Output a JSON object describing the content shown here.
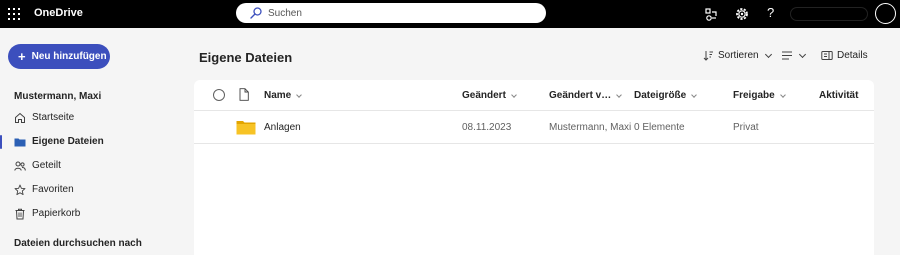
{
  "topbar": {
    "brand": "OneDrive",
    "search_placeholder": "Suchen",
    "help_label": "?"
  },
  "sidebar": {
    "new_button_label": "Neu hinzufügen",
    "user_name": "Mustermann, Maxi",
    "items": [
      {
        "label": "Startseite",
        "icon": "home-icon",
        "active": false
      },
      {
        "label": "Eigene Dateien",
        "icon": "folder-icon",
        "active": true
      },
      {
        "label": "Geteilt",
        "icon": "people-icon",
        "active": false
      },
      {
        "label": "Favoriten",
        "icon": "star-icon",
        "active": false
      },
      {
        "label": "Papierkorb",
        "icon": "trash-icon",
        "active": false
      }
    ],
    "browse_label": "Dateien durchsuchen nach"
  },
  "main": {
    "title": "Eigene Dateien",
    "commands": {
      "sort_label": "Sortieren",
      "details_label": "Details"
    },
    "columns": [
      "Name",
      "Geändert",
      "Geändert v…",
      "Dateigröße",
      "Freigabe",
      "Aktivität"
    ],
    "rows": [
      {
        "name": "Anlagen",
        "modified": "08.11.2023",
        "modified_by": "Mustermann, Maxi",
        "size": "0 Elemente",
        "sharing": "Privat",
        "activity": ""
      }
    ]
  },
  "colors": {
    "accent": "#3c4fbd",
    "folder": "#f2b300",
    "topbar": "#000000"
  }
}
